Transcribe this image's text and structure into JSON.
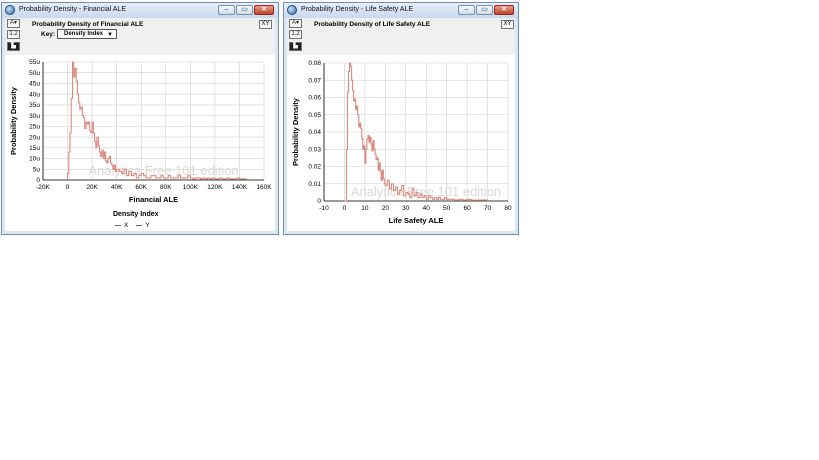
{
  "windows": [
    {
      "id": "financial",
      "title": "Probability Density - Financial ALE",
      "chart_title": "Probability Density of Financial ALE",
      "key_label": "Key:",
      "key_value": "Density Index",
      "xy_label": "XY",
      "legend": {
        "title": "Density Index",
        "items": [
          "X",
          "Y"
        ]
      },
      "watermark": "Analytica Free 101 edition"
    },
    {
      "id": "lifesafety",
      "title": "Probability Density - Life Safety ALE",
      "chart_title": "Probability Density of Life Safety ALE",
      "xy_label": "XY",
      "watermark": "Analytica Free 101 edition"
    }
  ],
  "window_buttons": {
    "minimize": "–",
    "restore": "▭",
    "close": "✕"
  },
  "toolbar_icons": [
    "graph-style-icon",
    "table-view-icon",
    "graph-view-icon"
  ],
  "colors": {
    "series": "#d98a80",
    "grid": "#d0d0d0",
    "window_frame": "#dbe6f3"
  },
  "chart_data": [
    {
      "type": "line",
      "step": true,
      "ylabel": "Probability Density",
      "xlabel": "Financial ALE",
      "xlim": [
        -20000,
        160000
      ],
      "ylim": [
        0,
        5.5e-05
      ],
      "x_ticks": [
        "-20K",
        "0",
        "20K",
        "40K",
        "60K",
        "80K",
        "100K",
        "120K",
        "140K",
        "160K"
      ],
      "y_ticks": [
        "0",
        "5u",
        "10u",
        "15u",
        "20u",
        "25u",
        "30u",
        "35u",
        "40u",
        "45u",
        "50u",
        "55u"
      ],
      "series": [
        {
          "x": [
            0,
            1000,
            2000,
            3000,
            4000,
            5000,
            6000,
            7000,
            8000,
            9000,
            10000,
            11000,
            12000,
            13000,
            14000,
            15000,
            16000,
            17000,
            18000,
            19000,
            20000,
            21000,
            22000,
            23000,
            24000,
            25000,
            26000,
            27000,
            28000,
            29000,
            30000,
            31000,
            32000,
            33000,
            34000,
            35000,
            36000,
            37000,
            38000,
            39000,
            40000,
            42000,
            44000,
            46000,
            48000,
            50000,
            52000,
            54000,
            56000,
            58000,
            60000,
            62000,
            64000,
            66000,
            68000,
            70000,
            72000,
            74000,
            76000,
            78000,
            80000,
            82000,
            84000,
            86000,
            88000,
            90000,
            92000,
            94000,
            96000,
            98000,
            100000,
            102000,
            104000,
            106000,
            108000,
            110000,
            112000,
            114000,
            116000,
            118000,
            120000,
            122000,
            124000,
            126000,
            128000,
            130000,
            132000,
            134000,
            136000,
            138000,
            140000,
            142000,
            144000,
            146000
          ],
          "y": [
            3e-06,
            1.3e-05,
            2.2e-05,
            3.8e-05,
            5.5e-05,
            4.8e-05,
            5.2e-05,
            4.6e-05,
            4e-05,
            3.6e-05,
            3.3e-05,
            3.4e-05,
            3e-05,
            2.9e-05,
            2.4e-05,
            2.7e-05,
            2.6e-05,
            2.7e-05,
            2.3e-05,
            2.2e-05,
            2.7e-05,
            2.2e-05,
            1.8e-05,
            1.5e-05,
            2e-05,
            1.6e-05,
            1.3e-05,
            1.1e-05,
            1.4e-05,
            1e-05,
            1.3e-05,
            9e-06,
            8e-06,
            1e-05,
            1.1e-05,
            8e-06,
            7e-06,
            5e-06,
            7e-06,
            4e-06,
            5e-06,
            4e-06,
            3e-06,
            5e-06,
            2e-06,
            4e-06,
            2e-06,
            3e-06,
            1e-06,
            2e-06,
            3e-06,
            2e-06,
            1e-06,
            1e-06,
            2e-06,
            2e-06,
            1e-06,
            1e-06,
            2e-06,
            1e-06,
            1e-06,
            2e-06,
            1e-06,
            1e-06,
            1e-06,
            2e-06,
            1e-06,
            1e-06,
            1e-06,
            2e-06,
            1e-06,
            5e-07,
            1e-06,
            1e-06,
            5e-07,
            1e-06,
            5e-07,
            1e-06,
            5e-07,
            1e-06,
            5e-07,
            5e-07,
            1e-06,
            5e-07,
            5e-07,
            1e-06,
            5e-07,
            5e-07,
            5e-07,
            1e-06,
            5e-07,
            5e-07,
            5e-07,
            0
          ]
        }
      ]
    },
    {
      "type": "line",
      "step": true,
      "ylabel": "Probability Density",
      "xlabel": "Life Safety ALE",
      "xlim": [
        -10,
        80
      ],
      "ylim": [
        0,
        0.08
      ],
      "x_ticks": [
        "-10",
        "0",
        "10",
        "20",
        "30",
        "40",
        "50",
        "60",
        "70",
        "80"
      ],
      "y_ticks": [
        "0",
        "0.01",
        "0.02",
        "0.03",
        "0.04",
        "0.05",
        "0.06",
        "0.07",
        "0.08"
      ],
      "series": [
        {
          "x": [
            0,
            1,
            1.5,
            2,
            2.5,
            3,
            3.5,
            4,
            4.5,
            5,
            5.5,
            6,
            6.5,
            7,
            7.5,
            8,
            8.5,
            9,
            9.5,
            10,
            10.5,
            11,
            11.5,
            12,
            12.5,
            13,
            13.5,
            14,
            14.5,
            15,
            15.5,
            16,
            16.5,
            17,
            17.5,
            18,
            18.5,
            19,
            19.5,
            20,
            21,
            22,
            23,
            24,
            25,
            26,
            27,
            28,
            29,
            30,
            31,
            32,
            33,
            34,
            35,
            36,
            37,
            38,
            39,
            40,
            41,
            42,
            43,
            44,
            45,
            46,
            47,
            48,
            49,
            50,
            52,
            54,
            56,
            58,
            60,
            62,
            64,
            66,
            68,
            70
          ],
          "y": [
            0,
            0.03,
            0.063,
            0.075,
            0.08,
            0.078,
            0.07,
            0.064,
            0.058,
            0.059,
            0.053,
            0.055,
            0.05,
            0.043,
            0.045,
            0.042,
            0.036,
            0.03,
            0.032,
            0.022,
            0.03,
            0.036,
            0.038,
            0.034,
            0.037,
            0.033,
            0.029,
            0.035,
            0.03,
            0.027,
            0.024,
            0.025,
            0.018,
            0.022,
            0.017,
            0.012,
            0.018,
            0.013,
            0.01,
            0.009,
            0.012,
            0.007,
            0.01,
            0.006,
            0.008,
            0.004,
            0.006,
            0.009,
            0.003,
            0.005,
            0.004,
            0.002,
            0.007,
            0.003,
            0.005,
            0.002,
            0.004,
            0.002,
            0.003,
            0.001,
            0.003,
            0.002,
            0.001,
            0.002,
            0.001,
            0.002,
            0.001,
            0.001,
            0.002,
            0.001,
            0.001,
            0.0005,
            0.001,
            0.0005,
            0.001,
            0.0005,
            0.0005,
            0.0005,
            0.0005,
            0
          ]
        }
      ]
    }
  ]
}
